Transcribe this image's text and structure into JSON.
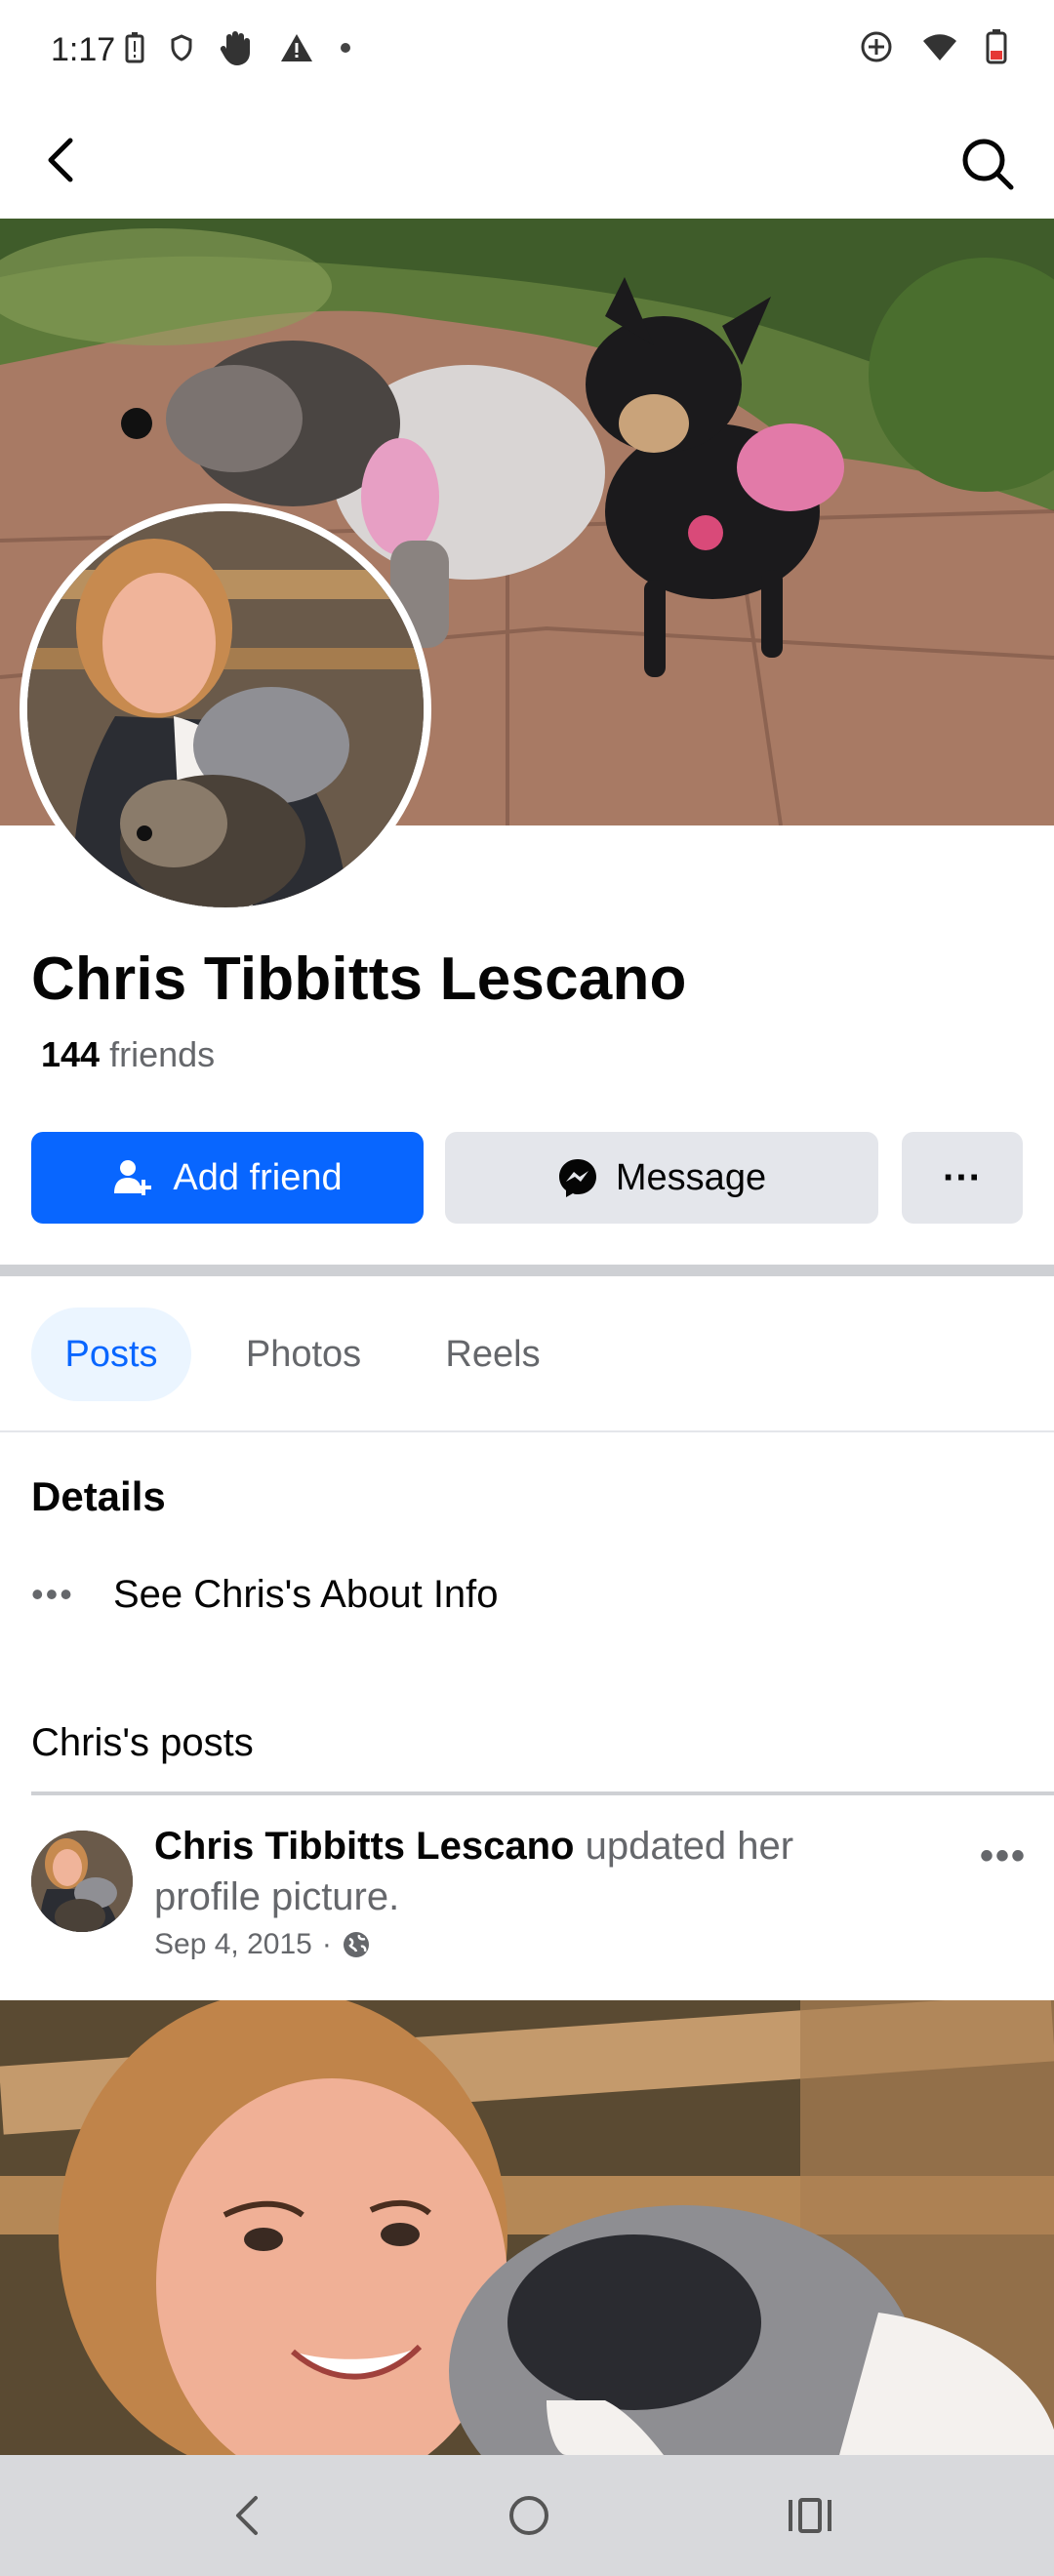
{
  "status_bar": {
    "time": "1:17"
  },
  "profile": {
    "name": "Chris Tibbitts Lescano",
    "friend_count": "144",
    "friends_label": "friends"
  },
  "actions": {
    "add_friend": "Add friend",
    "message": "Message",
    "more": "···"
  },
  "tabs": [
    {
      "label": "Posts",
      "selected": true
    },
    {
      "label": "Photos",
      "selected": false
    },
    {
      "label": "Reels",
      "selected": false
    }
  ],
  "details": {
    "title": "Details",
    "about_dots": "•••",
    "about_link": "See Chris's About Info"
  },
  "posts_section": {
    "title": "Chris's posts"
  },
  "post": {
    "author": "Chris Tibbitts Lescano",
    "action": "updated her profile picture.",
    "date": "Sep 4, 2015",
    "separator": "·",
    "more": "•••"
  },
  "colors": {
    "accent": "#0866ff",
    "secondary_button": "#e4e6eb",
    "muted_text": "#65676b"
  }
}
